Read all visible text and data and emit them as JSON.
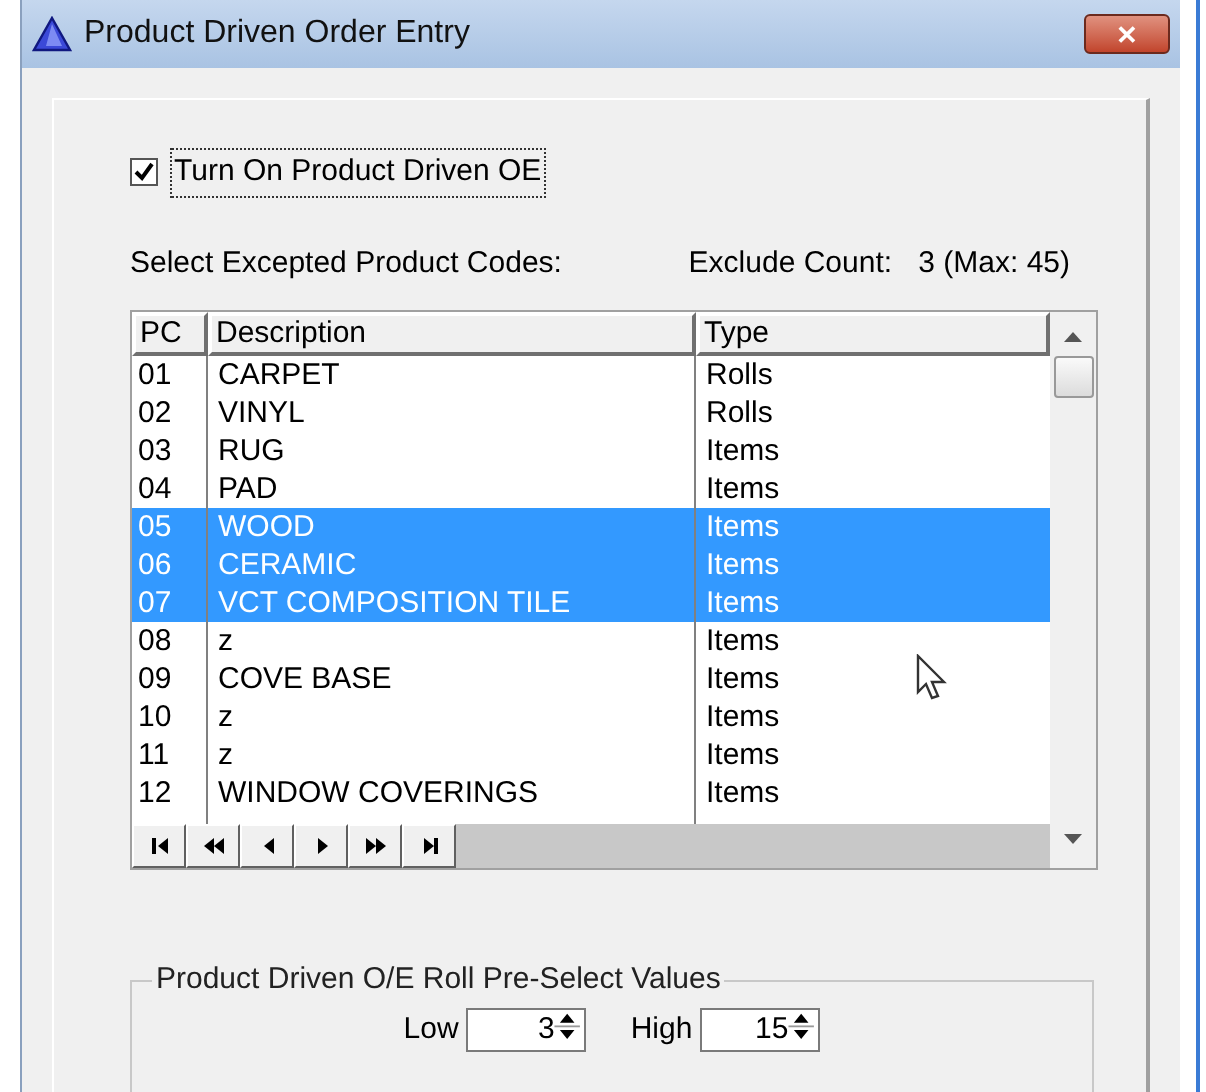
{
  "window": {
    "title": "Product Driven Order Entry",
    "close_glyph": "✕"
  },
  "enable_checkbox": {
    "label": "Turn On Product Driven OE",
    "checked": true
  },
  "list_label": "Select Excepted Product Codes:",
  "exclude_count": {
    "label": "Exclude Count:",
    "value": "3 (Max: 45)"
  },
  "table": {
    "columns": [
      "PC",
      "Description",
      "Type"
    ],
    "rows": [
      {
        "pc": "01",
        "description": "CARPET",
        "type": "Rolls",
        "selected": false
      },
      {
        "pc": "02",
        "description": "VINYL",
        "type": "Rolls",
        "selected": false
      },
      {
        "pc": "03",
        "description": "RUG",
        "type": "Items",
        "selected": false
      },
      {
        "pc": "04",
        "description": "PAD",
        "type": "Items",
        "selected": false
      },
      {
        "pc": "05",
        "description": "WOOD",
        "type": "Items",
        "selected": true
      },
      {
        "pc": "06",
        "description": "CERAMIC",
        "type": "Items",
        "selected": true
      },
      {
        "pc": "07",
        "description": "VCT COMPOSITION TILE",
        "type": "Items",
        "selected": true
      },
      {
        "pc": "08",
        "description": "z",
        "type": "Items",
        "selected": false
      },
      {
        "pc": "09",
        "description": "COVE BASE",
        "type": "Items",
        "selected": false
      },
      {
        "pc": "10",
        "description": "z",
        "type": "Items",
        "selected": false
      },
      {
        "pc": "11",
        "description": "z",
        "type": "Items",
        "selected": false
      },
      {
        "pc": "12",
        "description": "WINDOW COVERINGS",
        "type": "Items",
        "selected": false
      }
    ]
  },
  "roll_preselect": {
    "title": "Product Driven O/E Roll Pre-Select Values",
    "low": {
      "label": "Low",
      "value": "3"
    },
    "high": {
      "label": "High",
      "value": "15"
    }
  }
}
